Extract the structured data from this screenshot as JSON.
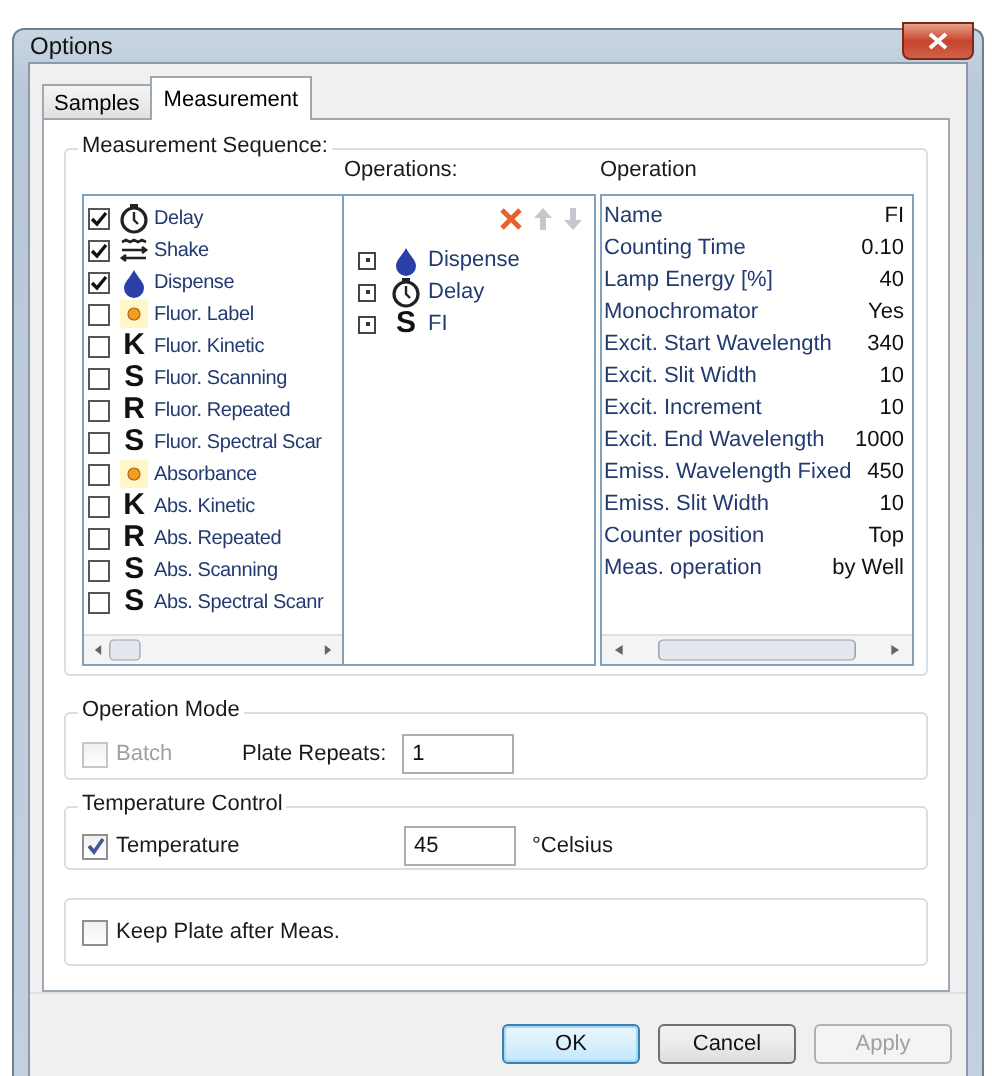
{
  "window": {
    "title": "Options"
  },
  "tabs": [
    {
      "label": "Samples",
      "selected": false
    },
    {
      "label": "Measurement",
      "selected": true
    }
  ],
  "measurement_sequence": {
    "title": "Measurement Sequence:",
    "items": [
      {
        "label": "Delay",
        "kind": "timer",
        "checked": true
      },
      {
        "label": "Shake",
        "kind": "shake",
        "checked": true
      },
      {
        "label": "Dispense",
        "kind": "drop",
        "checked": true
      },
      {
        "label": "Fluor. Label",
        "kind": "lamp",
        "checked": false
      },
      {
        "label": "Fluor. Kinetic",
        "kind": "letter",
        "glyph": "K",
        "checked": false
      },
      {
        "label": "Fluor. Scanning",
        "kind": "letter",
        "glyph": "S",
        "checked": false
      },
      {
        "label": "Fluor. Repeated",
        "kind": "letter",
        "glyph": "R",
        "checked": false
      },
      {
        "label": "Fluor. Spectral Scar",
        "kind": "letter",
        "glyph": "S",
        "checked": false
      },
      {
        "label": "Absorbance",
        "kind": "lamp",
        "checked": false
      },
      {
        "label": "Abs. Kinetic",
        "kind": "letter",
        "glyph": "K",
        "checked": false
      },
      {
        "label": "Abs. Repeated",
        "kind": "letter",
        "glyph": "R",
        "checked": false
      },
      {
        "label": "Abs. Scanning",
        "kind": "letter",
        "glyph": "S",
        "checked": false
      },
      {
        "label": "Abs. Spectral Scanr",
        "kind": "letter",
        "glyph": "S",
        "checked": false
      }
    ]
  },
  "operations": {
    "title": "Operations:",
    "items": [
      {
        "label": "Dispense",
        "kind": "drop"
      },
      {
        "label": "Delay",
        "kind": "timer"
      },
      {
        "label": "FI",
        "kind": "letter",
        "glyph": "S"
      }
    ]
  },
  "operation": {
    "title": "Operation",
    "rows": [
      {
        "name": "Name",
        "value": "FI"
      },
      {
        "name": "Counting Time",
        "value": "0.10"
      },
      {
        "name": "Lamp Energy [%]",
        "value": "40"
      },
      {
        "name": "Monochromator",
        "value": "Yes"
      },
      {
        "name": "Excit. Start Wavelength",
        "value": "340"
      },
      {
        "name": "Excit. Slit Width",
        "value": "10"
      },
      {
        "name": "Excit. Increment",
        "value": "10"
      },
      {
        "name": "Excit. End Wavelength",
        "value": "1000"
      },
      {
        "name": "Emiss. Wavelength Fixed",
        "value": "450"
      },
      {
        "name": "Emiss. Slit Width",
        "value": "10"
      },
      {
        "name": "Counter position",
        "value": "Top"
      },
      {
        "name": "Meas. operation",
        "value": "by Well"
      }
    ]
  },
  "operation_mode": {
    "title": "Operation Mode",
    "batch": {
      "label": "Batch",
      "checked": false,
      "disabled": true
    },
    "plate_repeats": {
      "label": "Plate Repeats:",
      "value": "1"
    }
  },
  "temperature_control": {
    "title": "Temperature Control",
    "temperature": {
      "label": "Temperature",
      "checked": true
    },
    "value": "45",
    "unit": "°Celsius"
  },
  "keep_plate": {
    "label": "Keep Plate after Meas.",
    "checked": false
  },
  "buttons": [
    {
      "label": "OK",
      "kind": "default",
      "disabled": false
    },
    {
      "label": "Cancel",
      "kind": "normal",
      "disabled": false
    },
    {
      "label": "Apply",
      "kind": "normal",
      "disabled": true
    }
  ]
}
